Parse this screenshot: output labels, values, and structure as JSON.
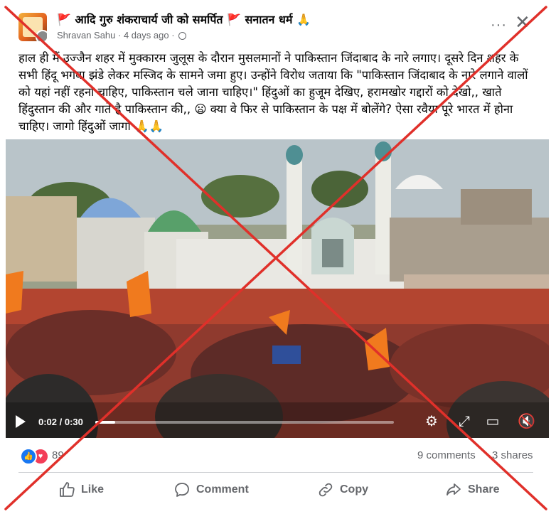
{
  "post": {
    "page_name": "🚩 आदि गुरु शंकराचार्य जी को समर्पित 🚩 सनातन धर्म 🙏",
    "author": "Shravan Sahu",
    "separator": " · ",
    "time": "4 days ago",
    "separator2": " · ",
    "text": "हाल ही में उज्जैन शहर में मुक्कारम जुलूस के दौरान मुसलमानों ने पाकिस्तान जिंदाबाद के नारे लगाए। दूसरे दिन शहर के सभी हिंदू भगवा झंडे लेकर मस्जिद के सामने जमा हुए। उन्होंने विरोध जताया कि \"पाकिस्तान जिंदाबाद के नारे लगाने वालों को यहां नहीं रहना चाहिए, पाकिस्तान चले जाना चाहिए।\" हिंदुओं का हुजूम देखिए, हरामखोर गद्दारों को देखो,, खाते हिंदुस्तान की और गाते है पाकिस्तान की,, 😦 क्या वे फिर से पाकिस्तान के पक्ष में बोलेंगे? ऐसा रवैया पूरे भारत में होना चाहिए। जागो हिंदुओं  जागो 🙏🙏"
  },
  "video": {
    "time_display": "0:02 / 0:30",
    "progress": 0.067,
    "icons": [
      "play-icon",
      "settings-icon",
      "fullscreen-icon",
      "pip-icon",
      "mute-icon"
    ]
  },
  "stats": {
    "reaction_count": "89",
    "comments": "9 comments",
    "shares": "3 shares"
  },
  "actions": {
    "like": "Like",
    "comment": "Comment",
    "copy": "Copy",
    "share": "Share"
  },
  "colors": {
    "fact_check_x": "#e0302a",
    "like_blue": "#1877f2",
    "love_red": "#f33e58",
    "saffron": "#f07a1e"
  }
}
